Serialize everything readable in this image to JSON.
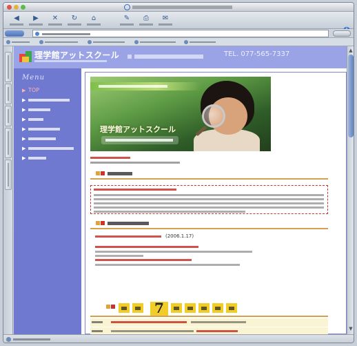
{
  "site": {
    "name": "理学館アットスクール",
    "tel": "TEL. 077-565-7337"
  },
  "menu": {
    "title": "Menu",
    "active_label": "TOP"
  },
  "hero": {
    "title": "理学館アットスクール"
  },
  "news": {
    "date": "(2006.1.17)"
  },
  "points": {
    "number": "7"
  },
  "colors": {
    "header_bg": "#9aa3e6",
    "sidebar_bg": "#6f79cf",
    "accent_red": "#c7342b",
    "accent_yellow": "#f1cd2a",
    "accent_orange": "#e3a13a"
  }
}
